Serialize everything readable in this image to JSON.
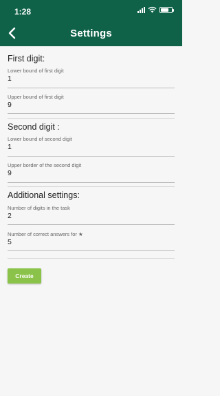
{
  "status_bar": {
    "time": "1:28"
  },
  "header": {
    "title": "Settings"
  },
  "first_digit": {
    "title": "First digit:",
    "lower": {
      "label": "Lower bound of first digit",
      "value": "1"
    },
    "upper": {
      "label": "Upper bound of first digit",
      "value": "9"
    }
  },
  "second_digit": {
    "title": "Second digit :",
    "lower": {
      "label": "Lower bound of second digit",
      "value": "1"
    },
    "upper": {
      "label": "Upper border of the second digit",
      "value": "9"
    }
  },
  "additional": {
    "title": "Additional settings:",
    "digits": {
      "label": "Number of digits in the task",
      "value": "2"
    },
    "correct": {
      "label": "Number of correct answers for ★",
      "value": "5"
    }
  },
  "actions": {
    "create_label": "Create"
  },
  "colors": {
    "header_bg": "#0f6248",
    "button_bg": "#8bc34a",
    "page_bg": "#f6f6f6"
  }
}
